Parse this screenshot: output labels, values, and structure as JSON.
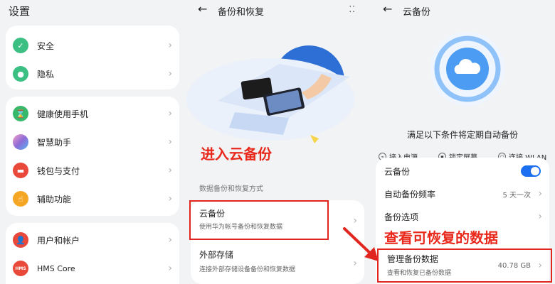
{
  "panel1": {
    "title": "设置",
    "items": [
      {
        "label": "安全",
        "icon": "shield-icon",
        "color": "#3bbf82"
      },
      {
        "label": "隐私",
        "icon": "privacy-icon",
        "color": "#3bbf82"
      },
      {
        "label": "健康使用手机",
        "icon": "hourglass-icon",
        "color": "#37b86b"
      },
      {
        "label": "智慧助手",
        "icon": "assistant-icon",
        "color": "#8e6bd8"
      },
      {
        "label": "钱包与支付",
        "icon": "wallet-icon",
        "color": "#e9493a"
      },
      {
        "label": "辅助功能",
        "icon": "hand-icon",
        "color": "#f5a623"
      },
      {
        "label": "用户和帐户",
        "icon": "user-icon",
        "color": "#e9493a"
      },
      {
        "label": "HMS Core",
        "icon": "hms-icon",
        "color": "#e9493a",
        "icon_text": "HMS"
      }
    ]
  },
  "panel2": {
    "title": "备份和恢复",
    "annotation": "进入云备份",
    "section_label": "数据备份和恢复方式",
    "items": [
      {
        "label": "云备份",
        "sub": "使用华为帐号备份和恢复数据"
      },
      {
        "label": "外部存储",
        "sub": "连接外部存储设备备份和恢复数据"
      }
    ]
  },
  "panel3": {
    "title": "云备份",
    "headline": "满足以下条件将定期自动备份",
    "conditions": [
      "接入电源",
      "锁定屏幕",
      "连接 WLAN"
    ],
    "annotation": "查看可恢复的数据",
    "rows": [
      {
        "label": "云备份",
        "toggle": true
      },
      {
        "label": "自动备份频率",
        "value": "5 天一次"
      },
      {
        "label": "备份选项"
      },
      {
        "label": "管理备份数据",
        "sub": "查看和恢复已备份数据",
        "value": "40.78 GB"
      }
    ]
  },
  "colors": {
    "accent": "#1d6ff2",
    "annotation": "#e8291c"
  }
}
